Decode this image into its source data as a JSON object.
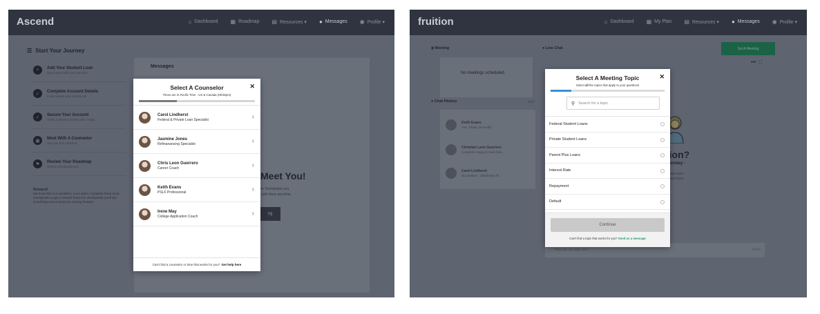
{
  "left": {
    "brand": "Ascend",
    "nav": [
      {
        "label": "Dashboard",
        "icon": "home-icon",
        "glyph": "⌂"
      },
      {
        "label": "Roadmap",
        "icon": "map-icon",
        "glyph": "▦"
      },
      {
        "label": "Resources ▾",
        "icon": "book-icon",
        "glyph": "▤"
      },
      {
        "label": "Messages",
        "icon": "chat-icon",
        "glyph": "●"
      },
      {
        "label": "Profile ▾",
        "icon": "user-icon",
        "glyph": "◉"
      }
    ],
    "journey_title": "Start Your Journey",
    "journey": [
      {
        "title": "Add Your Student Loan",
        "sub": "Sync loans with your servicer."
      },
      {
        "title": "Complete Account Details",
        "sub": "Know where your credit is at."
      },
      {
        "title": "Secure Your Account",
        "sub": "Verify a phone number with 2-Step."
      },
      {
        "title": "Meet With A Counselor",
        "sub": "Set your first check-in."
      },
      {
        "title": "Review Your Roadmap",
        "sub": "Submit checkpoint one."
      }
    ],
    "reward_title": "Reward!",
    "reward_text": "We know this is a marathon, not a sprint. Complete three more checkpoints to get a reward! Every ten checkpoints you'll win something new to keep you moving forward.",
    "messages_title": "Messages",
    "meet_text": "Meet You!",
    "meet_sub1": "lor. Remember you",
    "meet_sub2": "t with them any time.",
    "meet_btn": "ng",
    "modal": {
      "title": "Select A Counselor",
      "subtitle": "Times are in Pacific Time - US & Canada (08:56pm)",
      "progress": 0.33,
      "counselors": [
        {
          "name": "Carol Lindherst",
          "role": "Federal & Private Loan Specialist"
        },
        {
          "name": "Jasmine Jones",
          "role": "Refinanancing Specialist"
        },
        {
          "name": "Chris Leon Guerrero",
          "role": "Career Coach"
        },
        {
          "name": "Keith Evans",
          "role": "PSLF Professional"
        },
        {
          "name": "Irene May",
          "role": "College Application Coach"
        }
      ],
      "footer_text": "Can't find a counselor or time that works for you?",
      "footer_link": "Get help here"
    }
  },
  "right": {
    "brand": "fruition",
    "nav": [
      {
        "label": "Dashboard",
        "icon": "home-icon",
        "glyph": "⌂"
      },
      {
        "label": "My Plan",
        "icon": "map-icon",
        "glyph": "▦"
      },
      {
        "label": "Resources ▾",
        "icon": "book-icon",
        "glyph": "▤"
      },
      {
        "label": "Messages",
        "icon": "chat-icon",
        "glyph": "●"
      },
      {
        "label": "Profile ▾",
        "icon": "user-icon",
        "glyph": "◉"
      }
    ],
    "meeting_header": "Meeting",
    "no_meetings": "No meetings scheduled.",
    "livechat_header": "Live Chat",
    "set_meeting": "Set A Meeting",
    "chat_history": "Chat History",
    "edit": "EDIT",
    "chats": [
      {
        "name": "Keith Evans",
        "msg": "You: Thank you Keith!"
      },
      {
        "name": "Christian Leon Guerrero",
        "msg": "Congrats! Happy to hear that..."
      },
      {
        "name": "Carol Lindherst",
        "msg": "No problem - absolutely! I'll..."
      }
    ],
    "tion": "tion?",
    "monday": ") Monday -",
    "tion_sub1": "answer them",
    "tion_sub2": "siness hours.",
    "input_placeholder": "How can we help you?",
    "send": "Send",
    "modal": {
      "title": "Select A Meeting Topic",
      "subtitle_pre": "Select ",
      "subtitle_bold": "all",
      "subtitle_post": " the topics that apply to your questions",
      "progress": 0.18,
      "search_placeholder": "Search for a topic",
      "topics": [
        "Federal Student Loans",
        "Private Student Loans",
        "Parent Plus Loans",
        "Interest Rate",
        "Repayment",
        "Default"
      ],
      "continue": "Continue",
      "footer_text": "Can't find a topic that works for you?",
      "footer_link": "Send us a message"
    }
  }
}
